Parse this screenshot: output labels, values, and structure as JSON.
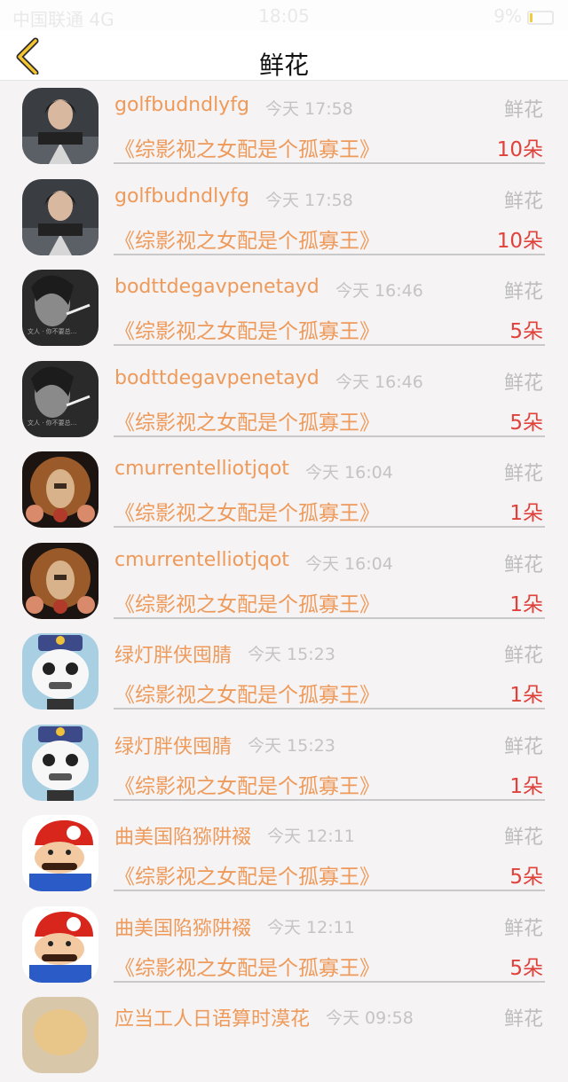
{
  "status_bar": {
    "carrier": "中国联通 4G",
    "time": "18:05",
    "battery": "9%"
  },
  "nav": {
    "title": "鲜花"
  },
  "colors": {
    "accent": "#ee9a5a",
    "count": "#e0413a",
    "muted": "#bdbdbd"
  },
  "items": [
    {
      "user": "golfbudndlyfg",
      "time": "今天 17:58",
      "gift": "鲜花",
      "book": "《综影视之女配是个孤寡王》",
      "count": "10朵",
      "avatar": "woman-warrior-avatar"
    },
    {
      "user": "golfbudndlyfg",
      "time": "今天 17:58",
      "gift": "鲜花",
      "book": "《综影视之女配是个孤寡王》",
      "count": "10朵",
      "avatar": "woman-warrior-avatar"
    },
    {
      "user": "bodttdegavpenetayd",
      "time": "今天 16:46",
      "gift": "鲜花",
      "book": "《综影视之女配是个孤寡王》",
      "count": "5朵",
      "avatar": "smoking-woman-avatar"
    },
    {
      "user": "bodttdegavpenetayd",
      "time": "今天 16:46",
      "gift": "鲜花",
      "book": "《综影视之女配是个孤寡王》",
      "count": "5朵",
      "avatar": "smoking-woman-avatar"
    },
    {
      "user": "cmurrentelliotjqot",
      "time": "今天 16:04",
      "gift": "鲜花",
      "book": "《综影视之女配是个孤寡王》",
      "count": "1朵",
      "avatar": "ornate-woman-avatar"
    },
    {
      "user": "cmurrentelliotjqot",
      "time": "今天 16:04",
      "gift": "鲜花",
      "book": "《综影视之女配是个孤寡王》",
      "count": "1朵",
      "avatar": "ornate-woman-avatar"
    },
    {
      "user": "绿灯胖侠囤腈",
      "time": "今天 15:23",
      "gift": "鲜花",
      "book": "《综影视之女配是个孤寡王》",
      "count": "1朵",
      "avatar": "panda-cartoon-avatar"
    },
    {
      "user": "绿灯胖侠囤腈",
      "time": "今天 15:23",
      "gift": "鲜花",
      "book": "《综影视之女配是个孤寡王》",
      "count": "1朵",
      "avatar": "panda-cartoon-avatar"
    },
    {
      "user": "曲美国陷猕阱裰",
      "time": "今天 12:11",
      "gift": "鲜花",
      "book": "《综影视之女配是个孤寡王》",
      "count": "5朵",
      "avatar": "mario-avatar"
    },
    {
      "user": "曲美国陷猕阱裰",
      "time": "今天 12:11",
      "gift": "鲜花",
      "book": "《综影视之女配是个孤寡王》",
      "count": "5朵",
      "avatar": "mario-avatar"
    },
    {
      "user": "应当工人日语算时漠花",
      "time": "今天 09:58",
      "gift": "鲜花",
      "book": "",
      "count": "",
      "avatar": "blonde-avatar"
    }
  ]
}
